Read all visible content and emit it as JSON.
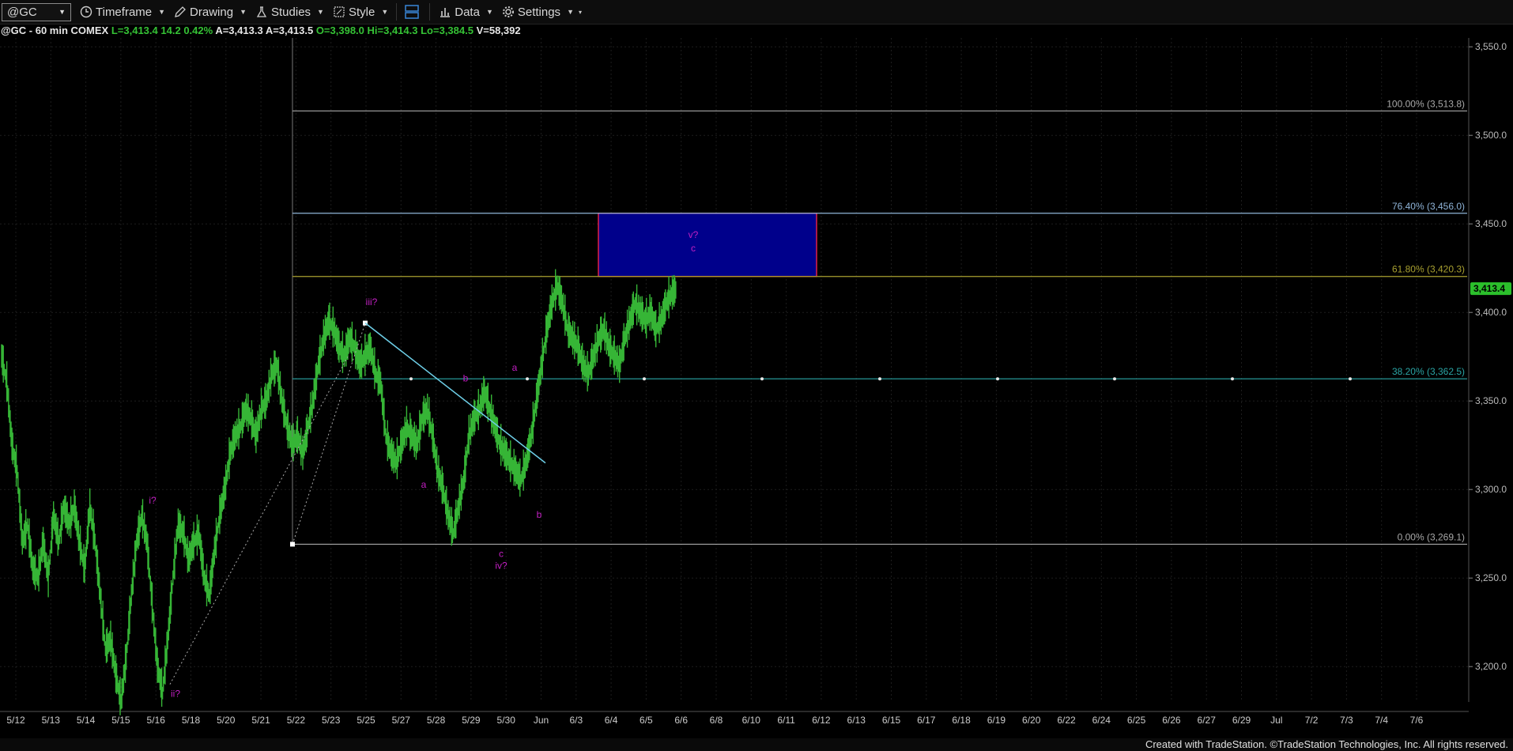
{
  "toolbar": {
    "symbol": "@GC",
    "timeframe": "Timeframe",
    "drawing": "Drawing",
    "studies": "Studies",
    "style": "Style",
    "data": "Data",
    "settings": "Settings"
  },
  "info": {
    "symbol": "@GC - 60 min",
    "exchange": "COMEX",
    "last": "L=3,413.4",
    "change": "14.2",
    "pct": "0.42%",
    "open_val": "A=3,413.3",
    "ask": "A=3,413.5",
    "open": "O=3,398.0",
    "high": "Hi=3,414.3",
    "low": "Lo=3,384.5",
    "volume": "V=58,392"
  },
  "footer": "Created with TradeStation. ©TradeStation Technologies, Inc. All rights reserved.",
  "chart_data": {
    "type": "line",
    "colors": {
      "price": "#36b536",
      "background": "#000000",
      "box_fill": "#00008b",
      "box_border": "#e0204a",
      "trend": "#6ecfe8",
      "label": "#c31fc3"
    },
    "price_axis": {
      "ticks": [
        3200,
        3250,
        3300,
        3350,
        3400,
        3450,
        3500,
        3550
      ],
      "tick_labels": [
        "3,200.0",
        "3,250.0",
        "3,300.0",
        "3,350.0",
        "3,400.0",
        "3,450.0",
        "3,500.0",
        "3,550.0"
      ],
      "ylim": [
        3180,
        3555
      ],
      "current": 3413.4,
      "current_label": "3,413.4"
    },
    "date_axis": [
      "5/12",
      "5/13",
      "5/14",
      "5/15",
      "5/16",
      "5/18",
      "5/20",
      "5/21",
      "5/22",
      "5/23",
      "5/25",
      "5/27",
      "5/28",
      "5/29",
      "5/30",
      "Jun",
      "6/3",
      "6/4",
      "6/5",
      "6/6",
      "6/8",
      "6/10",
      "6/11",
      "6/12",
      "6/13",
      "6/15",
      "6/17",
      "6/18",
      "6/19",
      "6/20",
      "6/22",
      "6/24",
      "6/25",
      "6/26",
      "6/27",
      "6/29",
      "Jul",
      "7/2",
      "7/3",
      "7/4",
      "7/6"
    ],
    "fib_levels": [
      {
        "pct": "100.00%",
        "value": 3513.8,
        "label": "100.00% (3,513.8)",
        "color": "#a8a8a8"
      },
      {
        "pct": "76.40%",
        "value": 3456.0,
        "label": "76.40% (3,456.0)",
        "color": "#8fb4d8"
      },
      {
        "pct": "61.80%",
        "value": 3420.3,
        "label": "61.80% (3,420.3)",
        "color": "#a8a030"
      },
      {
        "pct": "38.20%",
        "value": 3362.5,
        "label": "38.20% (3,362.5)",
        "color": "#2aa5a5"
      },
      {
        "pct": "0.00%",
        "value": 3269.1,
        "label": "0.00% (3,269.1)",
        "color": "#a8a8a8"
      }
    ],
    "target_box": {
      "low": 3420.3,
      "high": 3456.0,
      "from": "6/3",
      "to": "6/11"
    },
    "wave_labels": [
      "i?",
      "ii?",
      "iii?",
      "a",
      "b",
      "a",
      "b",
      "c",
      "iv?",
      "v?",
      "c"
    ],
    "series": [
      {
        "values": [
          3375,
          3360,
          3325,
          3310,
          3270,
          3280,
          3255,
          3250,
          3270,
          3250,
          3285,
          3270,
          3290,
          3280,
          3290,
          3270,
          3255,
          3290,
          3270,
          3240,
          3210,
          3215,
          3195,
          3180,
          3205,
          3240,
          3270,
          3285,
          3270,
          3235,
          3200,
          3185,
          3215,
          3250,
          3280,
          3275,
          3260,
          3270,
          3275,
          3250,
          3240,
          3265,
          3285,
          3300,
          3320,
          3330,
          3335,
          3345,
          3340,
          3330,
          3345,
          3350,
          3365,
          3370,
          3350,
          3335,
          3325,
          3330,
          3320,
          3335,
          3350,
          3370,
          3385,
          3395,
          3390,
          3380,
          3375,
          3385,
          3380,
          3370,
          3375,
          3380,
          3365,
          3360,
          3330,
          3320,
          3315,
          3325,
          3335,
          3330,
          3325,
          3340,
          3345,
          3330,
          3310,
          3300,
          3285,
          3275,
          3290,
          3305,
          3330,
          3340,
          3345,
          3355,
          3345,
          3335,
          3325,
          3320,
          3315,
          3310,
          3305,
          3315,
          3330,
          3350,
          3370,
          3390,
          3405,
          3415,
          3405,
          3390,
          3385,
          3380,
          3370,
          3365,
          3375,
          3385,
          3390,
          3380,
          3375,
          3370,
          3385,
          3395,
          3405,
          3400,
          3395,
          3400,
          3390,
          3395,
          3405,
          3410,
          3413
        ]
      }
    ]
  }
}
